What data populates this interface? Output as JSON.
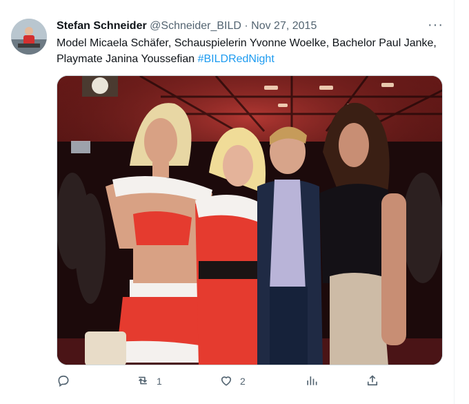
{
  "tweet": {
    "author_name": "Stefan Schneider",
    "handle": "@Schneider_BILD",
    "separator": "·",
    "date": "Nov 27, 2015",
    "more": "···",
    "text_plain": "Model Micaela Schäfer, Schauspielerin Yvonne Woelke, Bachelor Paul Janke, Playmate Janina Youssefian ",
    "hashtag": "#BILDRedNight"
  },
  "actions": {
    "reply_count": "",
    "retweet_count": "1",
    "like_count": "2",
    "views_count": ""
  },
  "icons": {
    "reply": "reply-icon",
    "retweet": "retweet-icon",
    "like": "heart-icon",
    "views": "views-icon",
    "share": "share-icon"
  },
  "colors": {
    "accent": "#1d9bf0",
    "secondary_text": "#536471",
    "primary_text": "#0f1419"
  }
}
